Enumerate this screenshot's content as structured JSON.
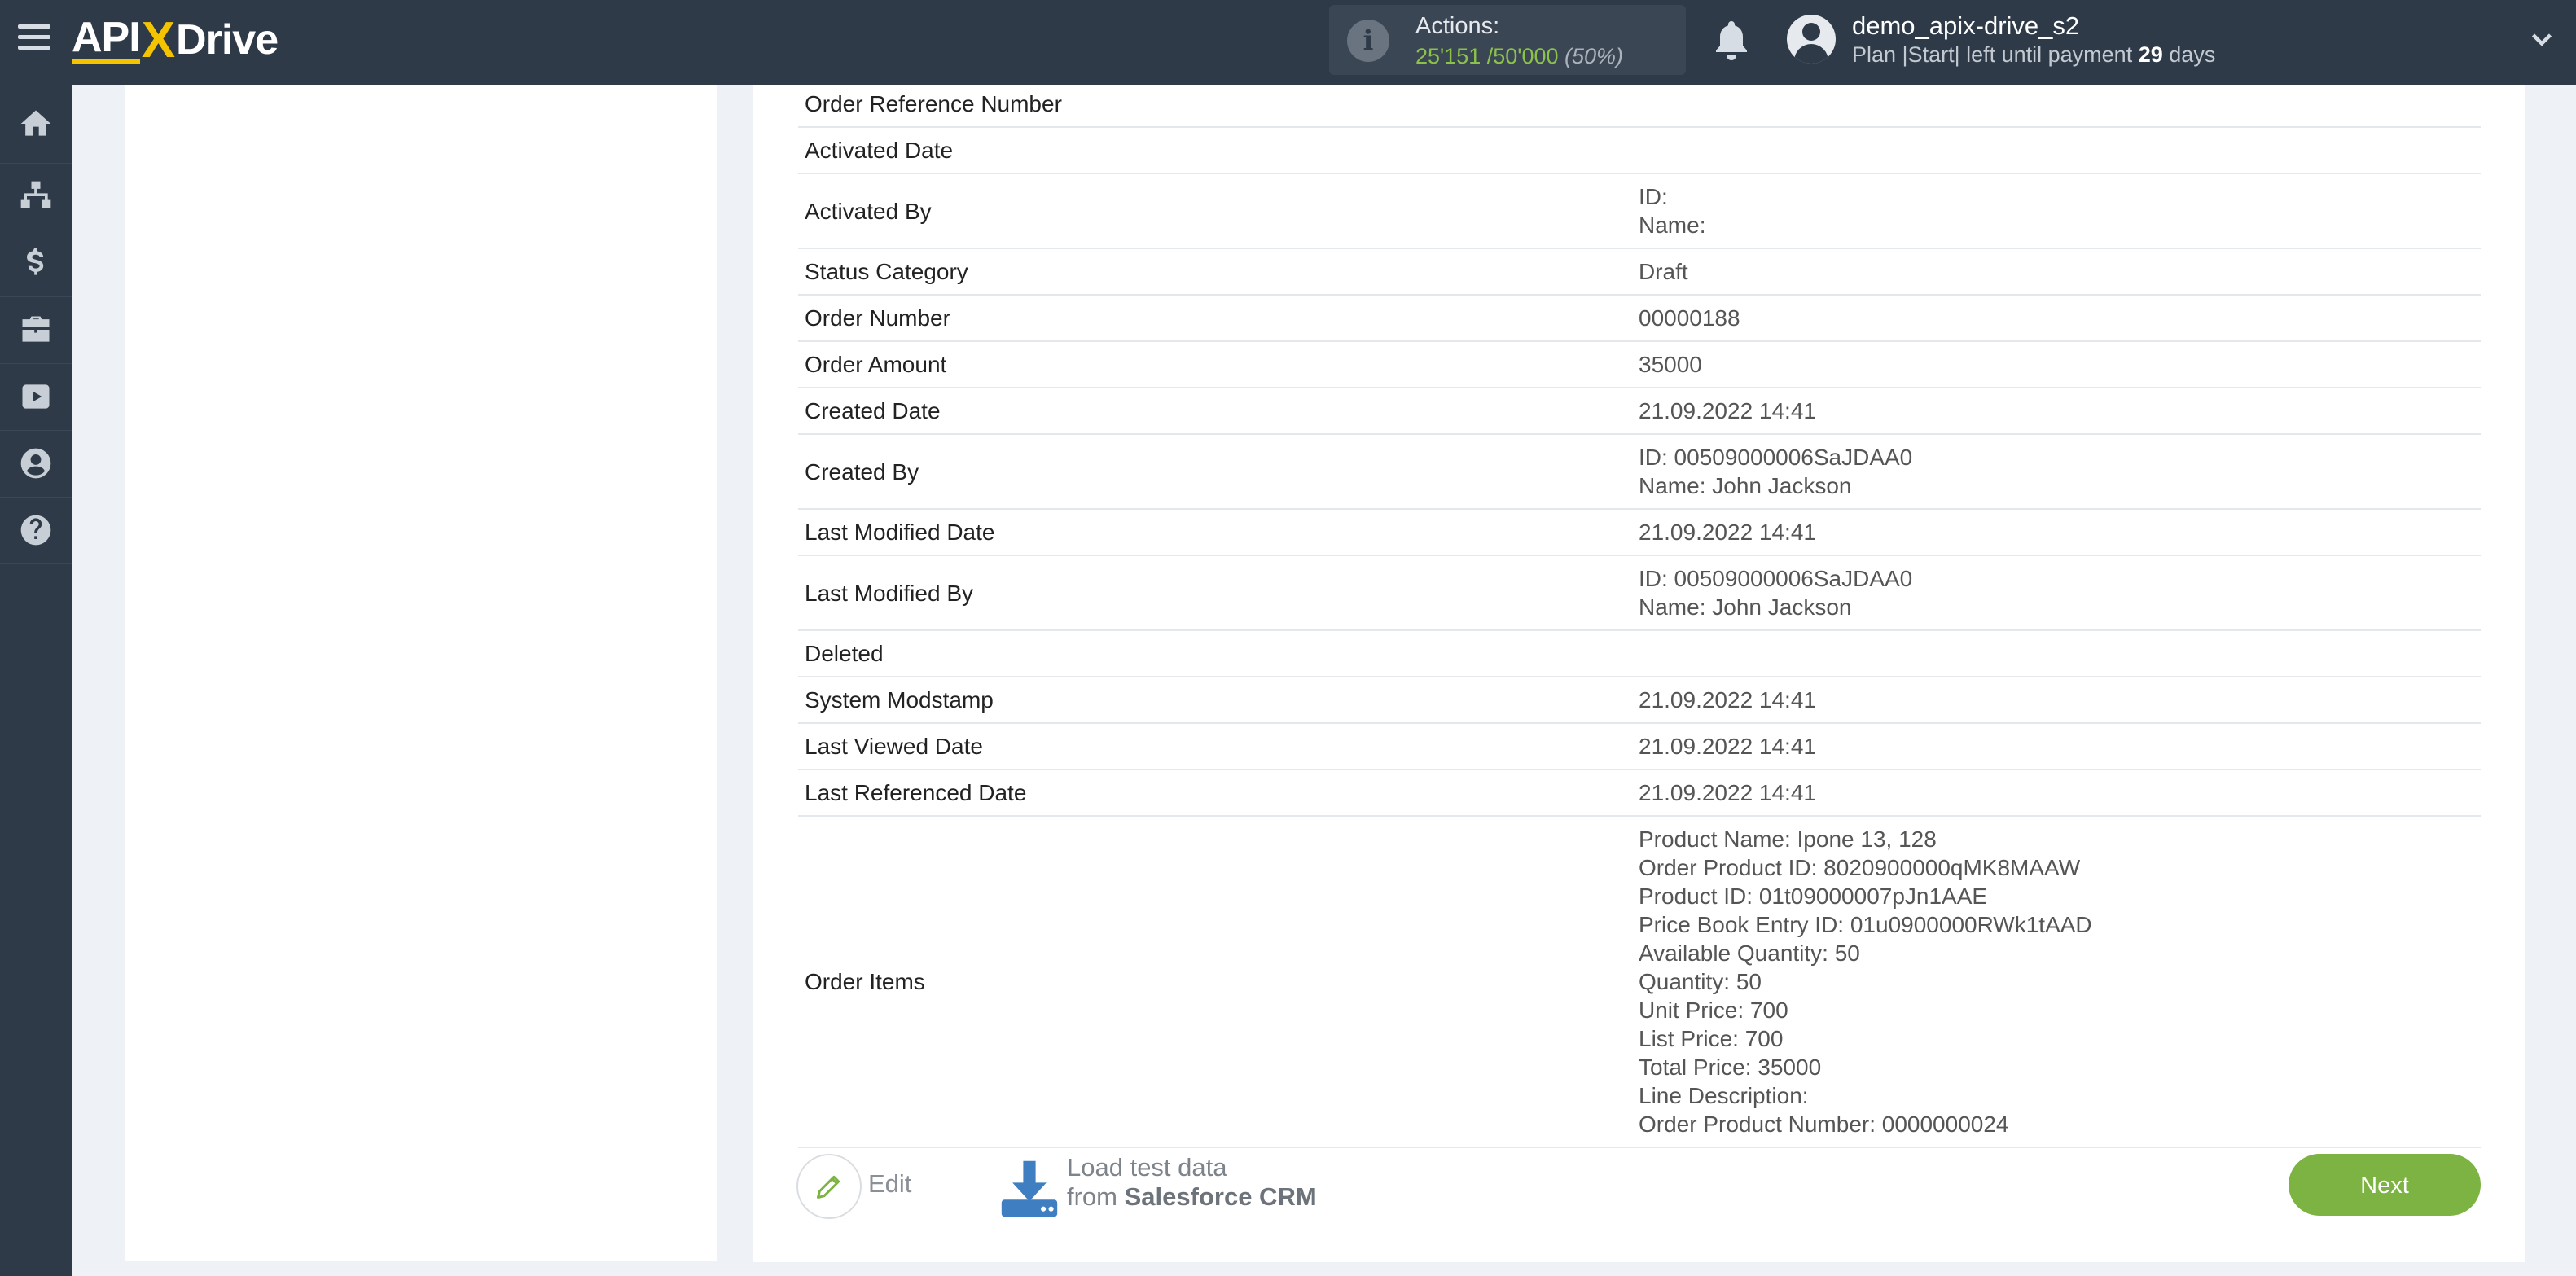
{
  "header": {
    "logo_api": "API",
    "logo_x": "X",
    "logo_drive": "Drive",
    "actions_label": "Actions:",
    "actions_used": "25'151",
    "actions_total": "/50'000",
    "actions_percent": "(50%)",
    "user_name": "demo_apix-drive_s2",
    "plan_prefix": "Plan |Start| left until payment",
    "days_count": "29",
    "days_label": "days"
  },
  "sidebar": {
    "items": [
      "home-icon",
      "sitemap-icon",
      "dollar-icon",
      "briefcase-icon",
      "youtube-icon",
      "user-circle-icon",
      "help-icon"
    ]
  },
  "fields": [
    {
      "key": "Order Reference Number",
      "value": []
    },
    {
      "key": "Activated Date",
      "value": []
    },
    {
      "key": "Activated By",
      "value": [
        "ID:",
        "Name:"
      ]
    },
    {
      "key": "Status Category",
      "value": [
        "Draft"
      ]
    },
    {
      "key": "Order Number",
      "value": [
        "00000188"
      ]
    },
    {
      "key": "Order Amount",
      "value": [
        "35000"
      ]
    },
    {
      "key": "Created Date",
      "value": [
        "21.09.2022 14:41"
      ]
    },
    {
      "key": "Created By",
      "value": [
        "ID: 00509000006SaJDAA0",
        "Name: John Jackson"
      ]
    },
    {
      "key": "Last Modified Date",
      "value": [
        "21.09.2022 14:41"
      ]
    },
    {
      "key": "Last Modified By",
      "value": [
        "ID: 00509000006SaJDAA0",
        "Name: John Jackson"
      ]
    },
    {
      "key": "Deleted",
      "value": []
    },
    {
      "key": "System Modstamp",
      "value": [
        "21.09.2022 14:41"
      ]
    },
    {
      "key": "Last Viewed Date",
      "value": [
        "21.09.2022 14:41"
      ]
    },
    {
      "key": "Last Referenced Date",
      "value": [
        "21.09.2022 14:41"
      ]
    },
    {
      "key": "Order Items",
      "value": [
        "Product Name: Ipone 13, 128",
        "Order Product ID: 8020900000qMK8MAAW",
        "Product ID: 01t09000007pJn1AAE",
        "Price Book Entry ID: 01u0900000RWk1tAAD",
        "Available Quantity: 50",
        "Quantity: 50",
        "Unit Price: 700",
        "List Price: 700",
        "Total Price: 35000",
        "Line Description:",
        "Order Product Number: 0000000024"
      ]
    }
  ],
  "footer": {
    "edit_label": "Edit",
    "load_line1": "Load test data",
    "load_from": "from",
    "load_source": "Salesforce CRM",
    "next_label": "Next"
  },
  "colors": {
    "topbar": "#2e3a48",
    "accent_green": "#7cb342",
    "logo_yellow": "#f5c400"
  }
}
